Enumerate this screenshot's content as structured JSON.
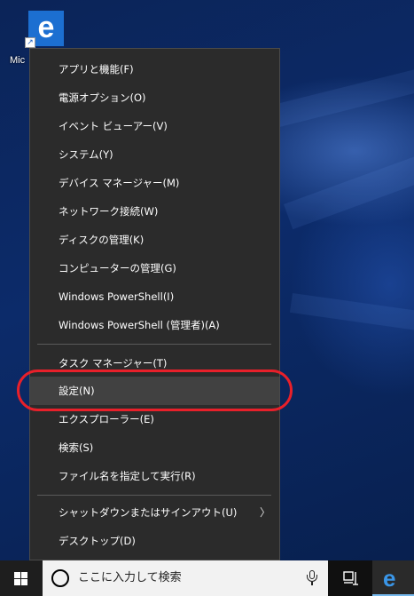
{
  "desktop": {
    "edge_shortcut_label": "Mic",
    "edge_glyph": "e"
  },
  "power_menu": {
    "items": [
      {
        "label": "アプリと機能(F)"
      },
      {
        "label": "電源オプション(O)"
      },
      {
        "label": "イベント ビューアー(V)"
      },
      {
        "label": "システム(Y)"
      },
      {
        "label": "デバイス マネージャー(M)"
      },
      {
        "label": "ネットワーク接続(W)"
      },
      {
        "label": "ディスクの管理(K)"
      },
      {
        "label": "コンピューターの管理(G)"
      },
      {
        "label": "Windows PowerShell(I)"
      },
      {
        "label": "Windows PowerShell (管理者)(A)"
      },
      {
        "label": "タスク マネージャー(T)"
      },
      {
        "label": "設定(N)"
      },
      {
        "label": "エクスプローラー(E)"
      },
      {
        "label": "検索(S)"
      },
      {
        "label": "ファイル名を指定して実行(R)"
      },
      {
        "label": "シャットダウンまたはサインアウト(U)"
      },
      {
        "label": "デスクトップ(D)"
      }
    ],
    "highlighted_item": "設定(N)",
    "submenu_arrow": "〉"
  },
  "taskbar": {
    "search_placeholder": "ここに入力して検索",
    "edge_glyph": "e"
  },
  "colors": {
    "highlight_ring": "#e8202a",
    "menu_background": "#2b2b2b",
    "menu_hover": "#414141",
    "accent": "#76b9ed"
  }
}
